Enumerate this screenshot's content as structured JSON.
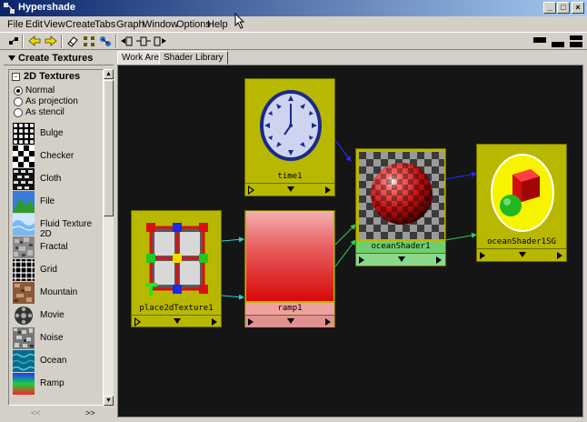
{
  "window": {
    "title": "Hypershade",
    "buttons": {
      "minimize": "_",
      "maximize": "□",
      "close": "×"
    }
  },
  "menubar": [
    "File",
    "Edit",
    "View",
    "Create",
    "Tabs",
    "Graph",
    "Window",
    "Options",
    "Help"
  ],
  "toolbar": {
    "icons": [
      "select-icon",
      "arrow-left-icon",
      "arrow-right-icon",
      "eraser-icon",
      "grid-icon",
      "graph-connect-icon",
      "input-connections-icon",
      "input-output-icon",
      "output-connections-icon"
    ]
  },
  "left_panel": {
    "header": "Create Textures",
    "section": "2D Textures",
    "section_toggle": "-",
    "radio_options": [
      {
        "label": "Normal",
        "selected": true
      },
      {
        "label": "As projection",
        "selected": false
      },
      {
        "label": "As stencil",
        "selected": false
      }
    ],
    "textures": [
      "Bulge",
      "Checker",
      "Cloth",
      "File",
      "Fluid Texture 2D",
      "Fractal",
      "Grid",
      "Mountain",
      "Movie",
      "Noise",
      "Ocean",
      "Ramp"
    ],
    "nav": {
      "left": "<<",
      "right": ">>"
    },
    "scroll": {
      "up": "▲",
      "down": "▼"
    }
  },
  "tabs": [
    {
      "label": "Work Area",
      "active": true
    },
    {
      "label": "Shader Library",
      "active": false
    }
  ],
  "nodes": {
    "time1": {
      "label": "time1"
    },
    "place2dTexture1": {
      "label": "place2dTexture1"
    },
    "ramp1": {
      "label": "ramp1"
    },
    "oceanShader1": {
      "label": "oceanShader1"
    },
    "oceanShader1SG": {
      "label": "oceanShader1SG"
    }
  },
  "colors": {
    "node_body": "#b8b800",
    "work_area_bg": "#151515",
    "wire_cyan": "#2ad6c8",
    "wire_green": "#33cc55",
    "wire_blue": "#2a2aff",
    "selected_label": "#6fcf6f"
  }
}
